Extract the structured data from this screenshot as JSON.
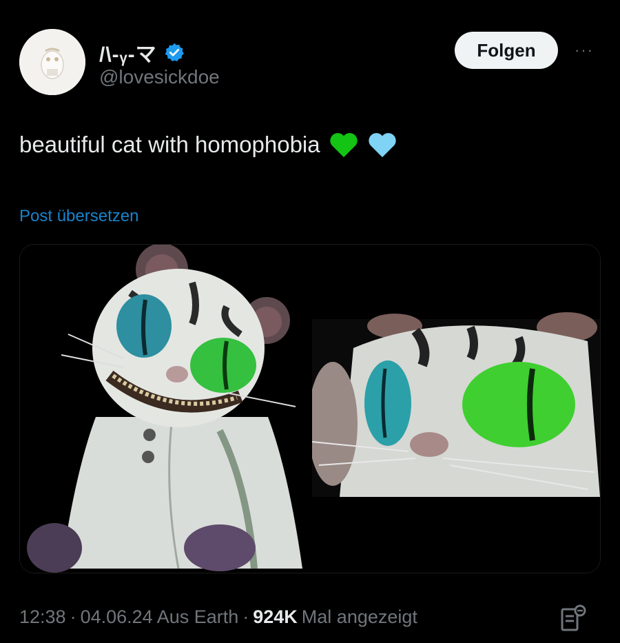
{
  "author": {
    "display_name": "/\\-ᵧ-マ",
    "handle": "@lovesickdoe",
    "verified": true
  },
  "follow_label": "Folgen",
  "more_label": "···",
  "tweet": {
    "text": "beautiful cat with homophobia",
    "emojis": [
      "green-heart",
      "light-blue-heart"
    ]
  },
  "translate_label": "Post übersetzen",
  "media": [
    {
      "alt_name": "cat-plush-full-body"
    },
    {
      "alt_name": "cat-plush-closeup"
    }
  ],
  "footer": {
    "time": "12:38",
    "sep1": "·",
    "date": "04.06.24",
    "location": "Aus Earth",
    "sep2": "·",
    "views": "924K",
    "views_label": "Mal angezeigt"
  },
  "colors": {
    "background": "#000000",
    "text": "#e7e9ea",
    "muted": "#71767b",
    "link": "#1d9bf0",
    "verified": "#1d9bf0",
    "green_heart": "#14c414",
    "light_blue_heart": "#7fd3f5"
  }
}
